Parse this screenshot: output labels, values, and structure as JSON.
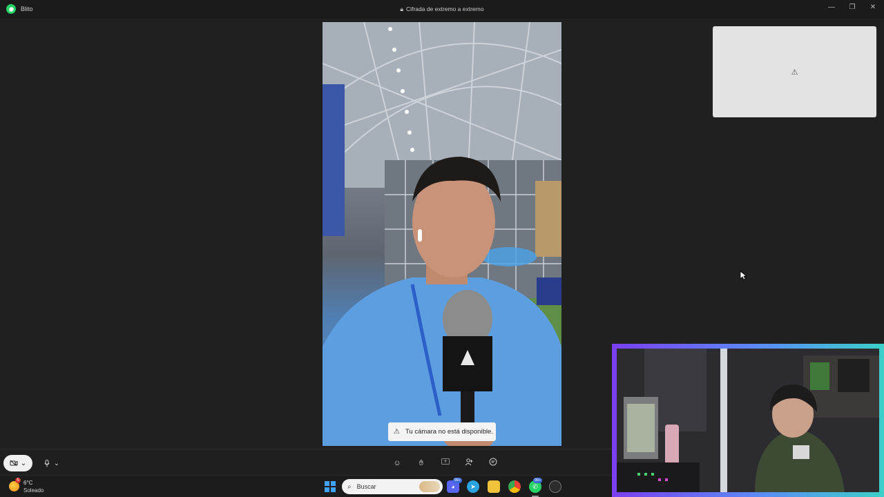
{
  "window": {
    "app_name": "Blito",
    "encryption_label": "Cifrada de extremo a extremo",
    "minimize_glyph": "—",
    "maximize_glyph": "❐",
    "close_glyph": "✕"
  },
  "call": {
    "camera_toast": "Tu cámara no está disponible.",
    "self_preview_icon": "warning-icon"
  },
  "controls": {
    "camera_icon": "camera-off-icon",
    "mic_icon": "microphone-icon",
    "chevron": "⌄",
    "center_icons": [
      "emoji-icon",
      "raise-hand-icon",
      "share-screen-icon",
      "add-participant-icon",
      "chat-icon"
    ]
  },
  "taskbar": {
    "weather_badge": "5",
    "weather_temp": "6°C",
    "weather_desc": "Soleado",
    "search_placeholder": "Buscar",
    "badge_discord": "99+",
    "badge_whatsapp": "99+"
  },
  "colors": {
    "whatsapp_green": "#25d366",
    "overlay_gradient_start": "#7a3ff0",
    "overlay_gradient_end": "#3bd0c8"
  }
}
